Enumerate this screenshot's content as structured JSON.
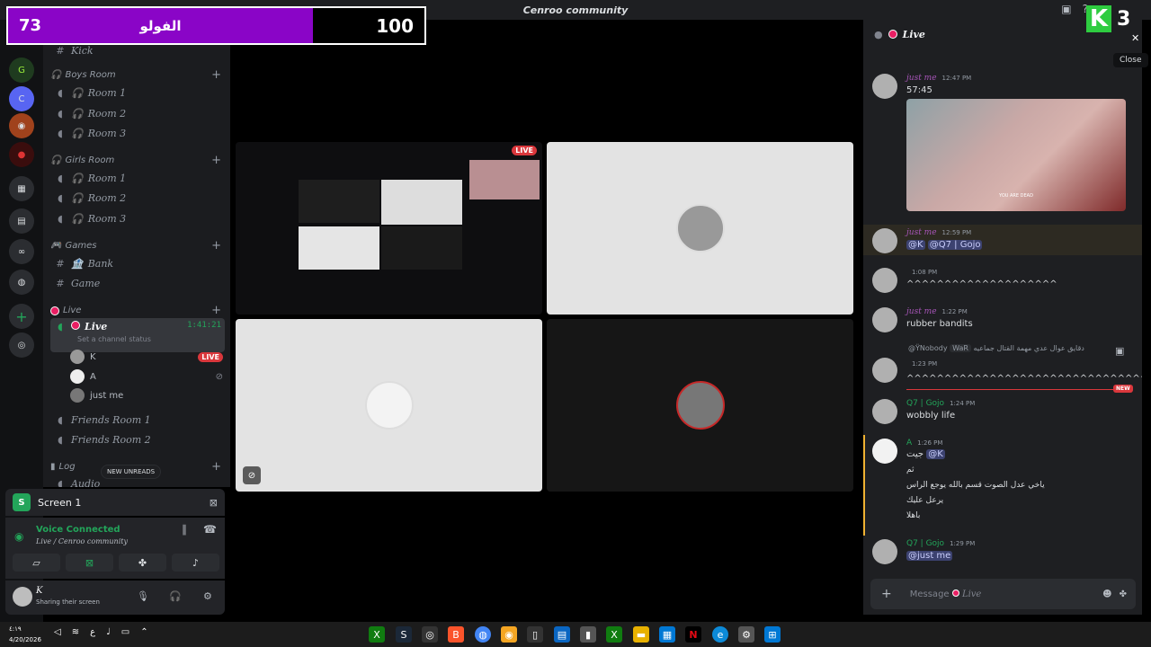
{
  "window": {
    "title": "Cenroo community"
  },
  "score": {
    "left_value": "73",
    "label": "الفولو",
    "right_value": "100"
  },
  "badge": {
    "letter": "K",
    "number": "3"
  },
  "colors": {
    "accent_purple": "#8a05c7",
    "live_red": "#da373c",
    "voice_green": "#23a55a",
    "badge_green": "#2ecc40"
  },
  "sidebar": {
    "partial_top": "Kick",
    "categories": {
      "boys": "Boys Room",
      "girls": "Girls Room",
      "games": "Games",
      "live": "Live",
      "log": "Log"
    },
    "channels": {
      "boys1": "Room 1",
      "boys2": "Room 2",
      "boys3": "Room 3",
      "girls1": "Room 1",
      "girls2": "Room 2",
      "girls3": "Room 3",
      "bank": "Bank",
      "game": "Game",
      "live": "Live",
      "friends1": "Friends Room 1",
      "friends2": "Friends Room 2",
      "audio": "Audio"
    },
    "live_time": "1:41:21",
    "live_status": "Set a channel status",
    "voice_users": [
      "K",
      "A",
      "just me"
    ],
    "live_badge": "LIVE",
    "new_unreads": "NEW UNREADS"
  },
  "screen_panel": {
    "label": "Screen 1"
  },
  "voice": {
    "title": "Voice Connected",
    "sub": "Live / Cenroo community"
  },
  "user": {
    "name": "K",
    "status": "Sharing their screen"
  },
  "stage": {
    "live_tag": "LIVE"
  },
  "chat": {
    "header": "Live",
    "close_tooltip": "Close",
    "messages": [
      {
        "name": "just me",
        "time": "12:47 PM",
        "text": "57:45",
        "image_caption": "YOU ARE DEAD"
      },
      {
        "name": "just me",
        "time": "12:59 PM",
        "mention1": "@K",
        "mention2": "@Q7 | Gojo"
      },
      {
        "time": "1:08 PM",
        "text": "^^^^^^^^^^^^^^^^^^^^"
      },
      {
        "name": "just me",
        "time": "1:22 PM",
        "text": "rubber bandits"
      },
      {
        "reply_user": "@Ÿ‌Nobody",
        "reply_tag": "WaR",
        "reply_text": "دقايق عوال عدي مهمة القتال جماعيه",
        "time": "1:23 PM",
        "text": "^^^^^^^^^^^^^^^^^^^^^^^^^^^^^^^^^^^^^^^^^^^^^^"
      },
      {
        "name": "Q7 | Gojo",
        "time": "1:24 PM",
        "text": "wobbly life"
      },
      {
        "name": "A",
        "time": "1:26 PM",
        "line1": "جيت",
        "mention": "@K",
        "line2": "ثم",
        "line3": "ياخي عدل الصوت قسم بالله يوجع الراس",
        "line4": "يرعل عليك",
        "line5": "باهلا"
      },
      {
        "name": "Q7 | Gojo",
        "time": "1:29 PM",
        "mention": "@just me"
      }
    ],
    "new_tag": "NEW",
    "composer_prefix": "Message",
    "composer_channel": "Live"
  },
  "taskbar": {
    "time": "٤:١٩",
    "date": "4/20/2026"
  }
}
